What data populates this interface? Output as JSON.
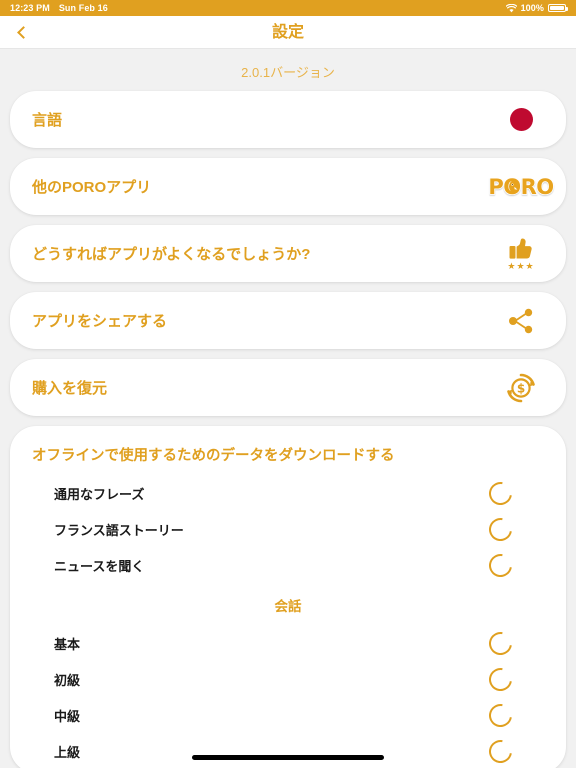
{
  "status_bar": {
    "time": "12:23 PM",
    "date": "Sun Feb 16",
    "battery_percent": "100%",
    "wifi_icon": "wifi-icon",
    "battery_icon": "battery-icon"
  },
  "nav": {
    "back_icon": "chevron-left-icon",
    "title": "設定"
  },
  "version_label": "2.0.1バージョン",
  "colors": {
    "accent": "#E0A020",
    "accent_light": "#E8B34A",
    "background": "#F1F1F1",
    "card": "#FFFFFF",
    "flag_red": "#BF0A30",
    "text_dark": "#1A1A1A"
  },
  "menu_rows": [
    {
      "label": "言語",
      "icon": "japan-flag-icon"
    },
    {
      "label": "他のPOROアプリ",
      "icon": "poro-logo-icon",
      "logo_text": "PORO"
    },
    {
      "label": "どうすればアプリがよくなるでしょうか?",
      "icon": "thumbs-up-icon",
      "stars": "★★★"
    },
    {
      "label": "アプリをシェアする",
      "icon": "share-icon"
    },
    {
      "label": "購入を復元",
      "icon": "restore-purchase-icon"
    }
  ],
  "download_section": {
    "title": "オフラインで使用するためのデータをダウンロードする",
    "items": [
      {
        "name": "通用なフレーズ",
        "icon": "loading-spinner-icon"
      },
      {
        "name": "フランス語ストーリー",
        "icon": "loading-spinner-icon"
      },
      {
        "name": "ニュースを聞く",
        "icon": "loading-spinner-icon"
      }
    ],
    "subsection_title": "会話",
    "subsection_items": [
      {
        "name": "基本",
        "icon": "loading-spinner-icon"
      },
      {
        "name": "初級",
        "icon": "loading-spinner-icon"
      },
      {
        "name": "中級",
        "icon": "loading-spinner-icon"
      },
      {
        "name": "上級",
        "icon": "loading-spinner-icon"
      }
    ]
  }
}
